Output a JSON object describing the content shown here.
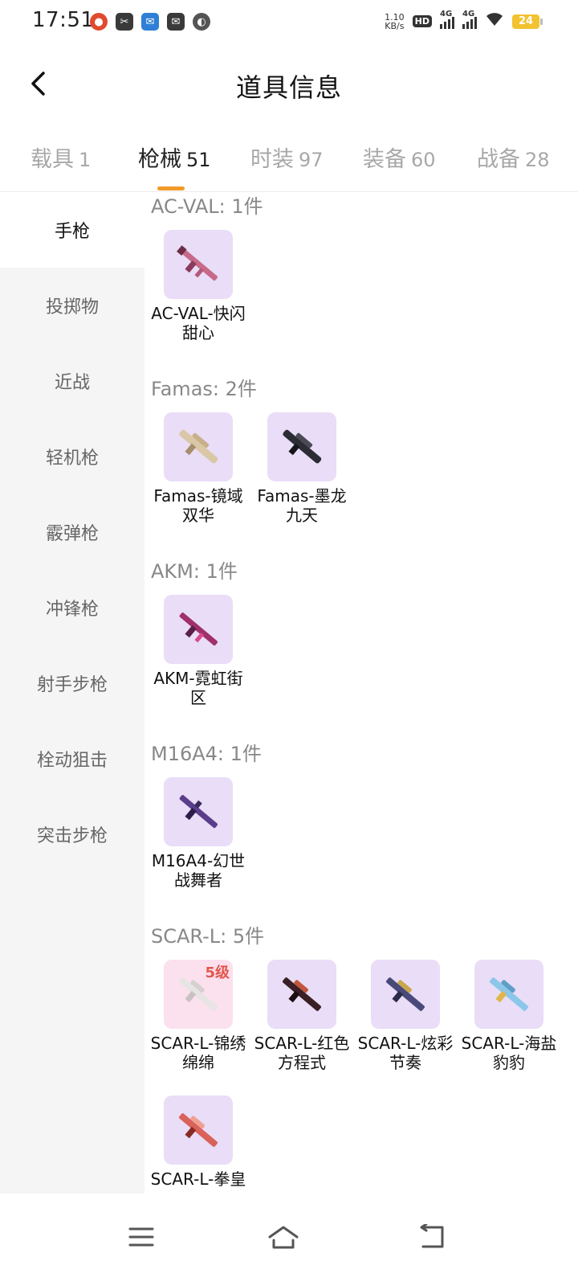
{
  "status_bar": {
    "time": "17:51",
    "net_speed_value": "1.10",
    "net_speed_unit": "KB/s",
    "hd_label": "HD",
    "network_1": "4G",
    "network_2": "4G",
    "battery": "24"
  },
  "header": {
    "title": "道具信息",
    "back_icon": "chevron-left-icon"
  },
  "tabs": [
    {
      "label": "载具",
      "count": "1"
    },
    {
      "label": "枪械",
      "count": "51"
    },
    {
      "label": "时装",
      "count": "97"
    },
    {
      "label": "装备",
      "count": "60"
    },
    {
      "label": "战备",
      "count": "28"
    }
  ],
  "active_tab_index": 1,
  "accent_color": "#f29b2a",
  "sidebar": {
    "items": [
      "手枪",
      "投掷物",
      "近战",
      "轻机枪",
      "霰弹枪",
      "冲锋枪",
      "射手步枪",
      "栓动狙击",
      "突击步枪"
    ],
    "active_index": 0
  },
  "groups": [
    {
      "title": "AC-VAL: 1件",
      "items": [
        {
          "name": "AC-VAL-快闪甜心"
        }
      ]
    },
    {
      "title": "Famas: 2件",
      "items": [
        {
          "name": "Famas-镜域双华"
        },
        {
          "name": "Famas-墨龙九天"
        }
      ]
    },
    {
      "title": "AKM: 1件",
      "items": [
        {
          "name": "AKM-霓虹街区"
        }
      ]
    },
    {
      "title": "M16A4: 1件",
      "items": [
        {
          "name": "M16A4-幻世战舞者"
        }
      ]
    },
    {
      "title": "SCAR-L: 5件",
      "items": [
        {
          "name": "SCAR-L-锦绣绵绵",
          "level": "5级"
        },
        {
          "name": "SCAR-L-红色方程式"
        },
        {
          "name": "SCAR-L-炫彩节奏"
        },
        {
          "name": "SCAR-L-海盐豹豹"
        },
        {
          "name": "SCAR-L-拳皇"
        }
      ]
    }
  ],
  "nav_bar": {
    "menu_icon": "menu-icon",
    "home_icon": "home-icon",
    "back_icon": "back-icon"
  }
}
